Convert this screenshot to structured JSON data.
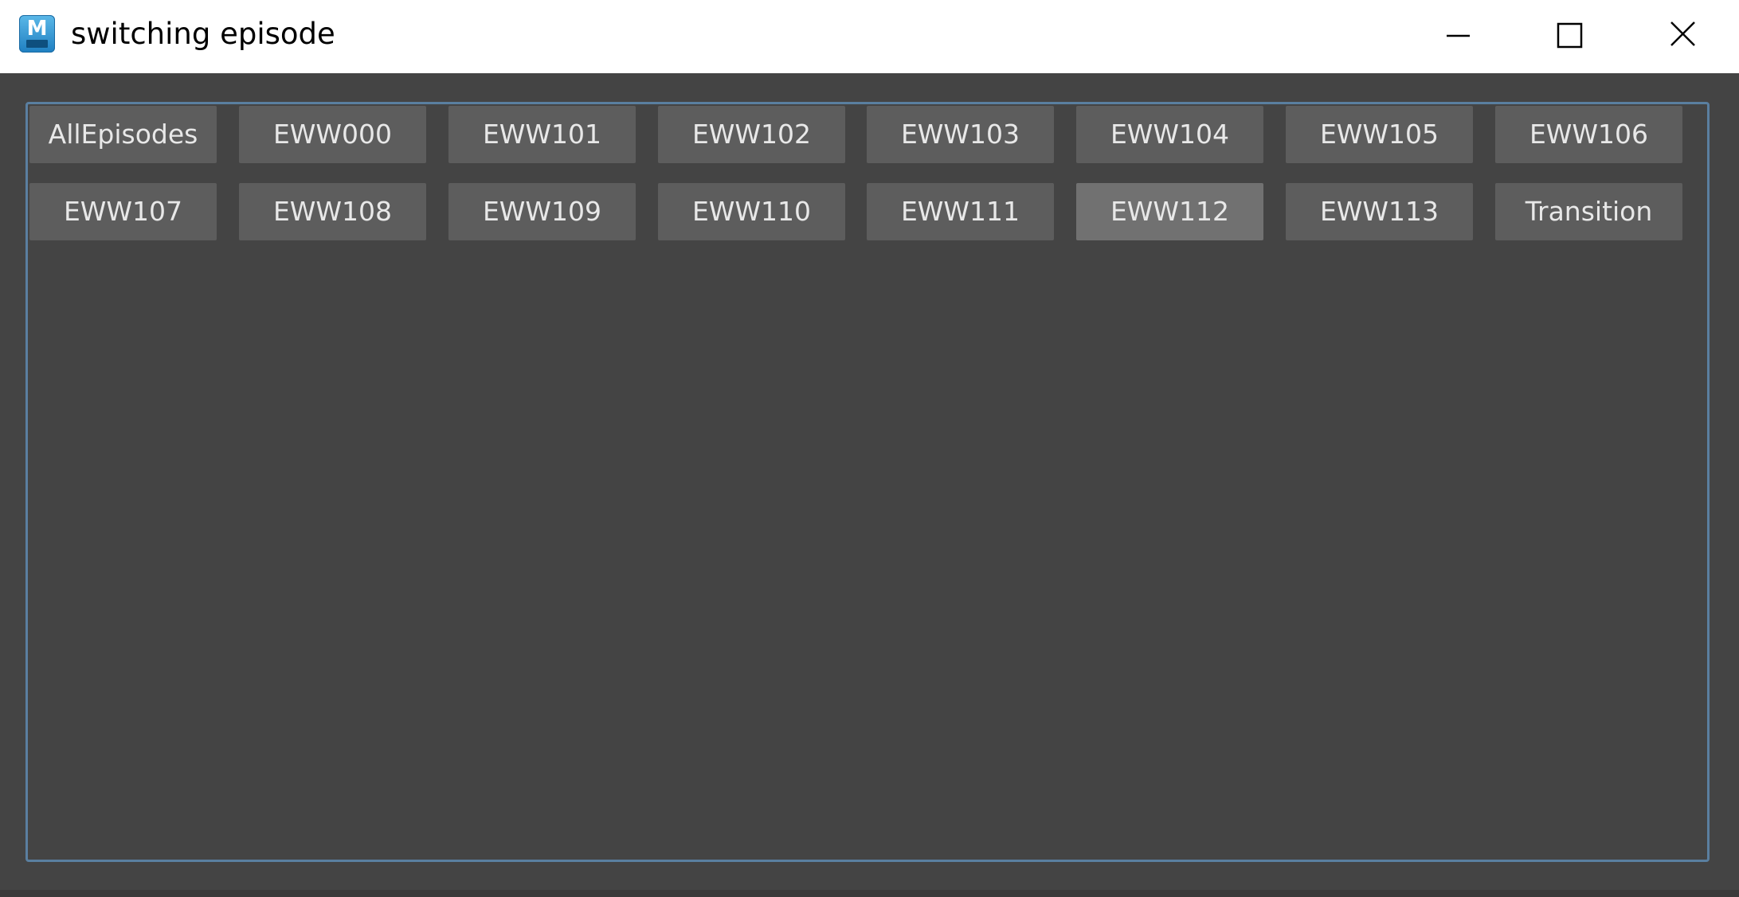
{
  "window": {
    "title": "switching episode",
    "app_icon": "maya-app-icon",
    "app_icon_letter": "M",
    "controls": [
      "minimize-icon",
      "maximize-icon",
      "close-icon"
    ]
  },
  "colors": {
    "background": "#444444",
    "button": "#5d5d5d",
    "button_hover": "#717171",
    "frame_border": "#5a7fa0",
    "button_text": "#e8e8e8"
  },
  "episodes": {
    "b0": "AllEpisodes",
    "b1": "EWW000",
    "b2": "EWW101",
    "b3": "EWW102",
    "b4": "EWW103",
    "b5": "EWW104",
    "b6": "EWW105",
    "b7": "EWW106",
    "b8": "EWW107",
    "b9": "EWW108",
    "b10": "EWW109",
    "b11": "EWW110",
    "b12": "EWW111",
    "b13": "EWW112",
    "b14": "EWW113",
    "b15": "Transition"
  },
  "hovered_button": "EWW112"
}
